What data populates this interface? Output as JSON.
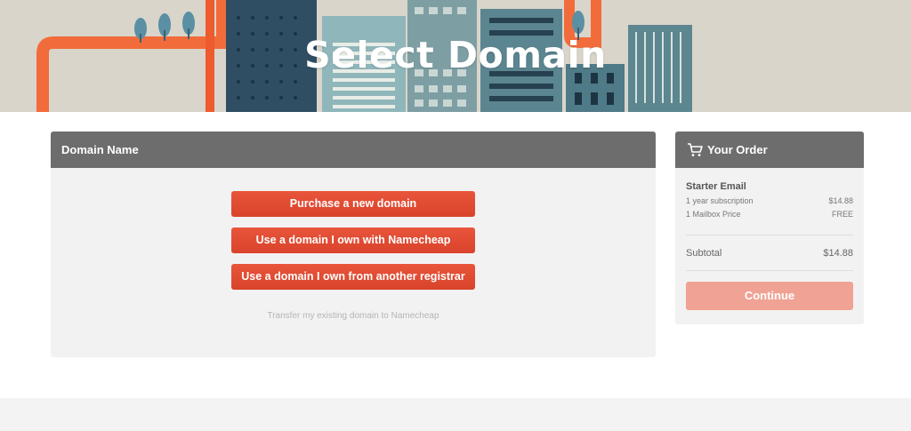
{
  "hero": {
    "title": "Select Domain",
    "colors": {
      "ribbon": "#f26c3b",
      "building_dark": "#2f4e63",
      "building_teal": "#6f9aa3",
      "background": "#d9d5cb"
    }
  },
  "domain_panel": {
    "heading": "Domain Name",
    "buttons": [
      {
        "label": "Purchase a new domain"
      },
      {
        "label": "Use a domain I own with Namecheap"
      },
      {
        "label": "Use a domain I own from another registrar"
      }
    ],
    "transfer_link": "Transfer my existing domain to Namecheap",
    "button_color": "#e04a30"
  },
  "order_panel": {
    "heading": "Your Order",
    "icon": "cart-icon",
    "item_name": "Starter Email",
    "lines": [
      {
        "label": "1 year subscription",
        "value": "$14.88"
      },
      {
        "label": "1 Mailbox Price",
        "value": "FREE"
      }
    ],
    "subtotal_label": "Subtotal",
    "subtotal_value": "$14.88",
    "continue_label": "Continue",
    "continue_color": "#f0a294"
  }
}
